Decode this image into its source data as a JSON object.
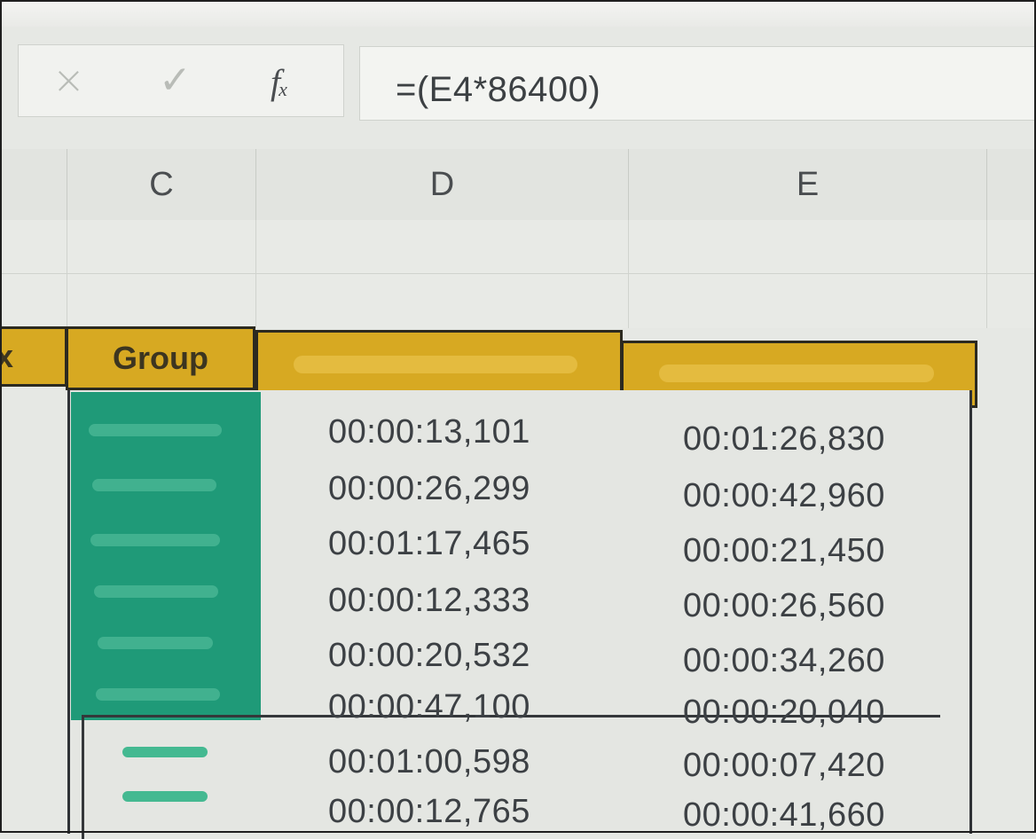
{
  "formula_bar": {
    "cancel_icon": "×",
    "enter_icon": "✓",
    "fx_label": "f",
    "fx_sub": "x",
    "formula": "=(E4*86400)"
  },
  "columns": {
    "c": "C",
    "d": "D",
    "e": "E"
  },
  "table": {
    "prev_col_header_fragment": "x",
    "group_header": "Group",
    "col_d_values": [
      "00:00:13,101",
      "00:00:26,299",
      "00:01:17,465",
      "00:00:12,333",
      "00:00:20,532",
      "00:00:47,100",
      "00:01:00,598",
      "00:00:12,765"
    ],
    "col_e_values": [
      "00:01:26,830",
      "00:00:42,960",
      "00:00:21,450",
      "00:00:26,560",
      "00:00:34,260",
      "00:00:20,040",
      "00:00:07,420",
      "00:00:41,660"
    ]
  },
  "colors": {
    "header_fill": "#d7a922",
    "group_fill": "#1f9a78"
  }
}
